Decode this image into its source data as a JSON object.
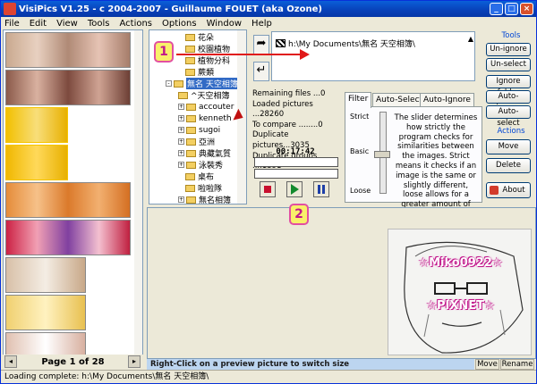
{
  "window": {
    "title": "VisiPics V1.25 - c 2004-2007 - Guillaume FOUET (aka Ozone)"
  },
  "menu": [
    "File",
    "Edit",
    "View",
    "Tools",
    "Actions",
    "Options",
    "Window",
    "Help"
  ],
  "tree": {
    "items": [
      {
        "label": "花朵",
        "expander": ""
      },
      {
        "label": "校園植物",
        "expander": ""
      },
      {
        "label": "植物分科",
        "expander": ""
      },
      {
        "label": "蕨類",
        "expander": ""
      },
      {
        "label": "無名 天空相簿",
        "expander": "-",
        "selected": true
      },
      {
        "label": "^天空相簿",
        "expander": ""
      },
      {
        "label": "accouter",
        "expander": "+"
      },
      {
        "label": "kenneth",
        "expander": "+"
      },
      {
        "label": "sugoi",
        "expander": "+"
      },
      {
        "label": "亞洲",
        "expander": "+"
      },
      {
        "label": "典藏氣質",
        "expander": "+"
      },
      {
        "label": "泳裝秀",
        "expander": "+"
      },
      {
        "label": "桌布",
        "expander": ""
      },
      {
        "label": "啦啦隊",
        "expander": ""
      },
      {
        "label": "無名相簿",
        "expander": "+"
      }
    ]
  },
  "path_list": {
    "entry": "h:\\My Documents\\無名 天空相簿\\"
  },
  "stats": {
    "remaining": "Remaining files ...0",
    "loaded": "Loaded pictures ...28260",
    "compare": "To compare ........0",
    "dup_pictures": "Duplicate pictures...3035",
    "dup_groups": "Duplicate groups ....1391"
  },
  "timer": "00:17:42",
  "tabs": [
    "Filter",
    "Auto-Select",
    "Auto-Ignore"
  ],
  "filter": {
    "ticks": [
      "Strict",
      "Basic",
      "Loose"
    ],
    "level_label": "Basic",
    "description": "The slider determines how strictly the program checks for similarities between the images. Strict means it checks if an image is the same or slightly different, loose allows for a greater amount of differences."
  },
  "right_panel": {
    "tools_label": "Tools",
    "tools": [
      "Un-ignore",
      "Un-select",
      "Ignore folder",
      "Auto-ignore",
      "Auto-select"
    ],
    "actions_label": "Actions",
    "actions": [
      "Move",
      "Delete"
    ],
    "about": "About"
  },
  "left": {
    "page": "Page 1 of 28"
  },
  "annotations": {
    "badge1": "1",
    "badge2": "2"
  },
  "preview": {
    "watermark_top": "☆Miko0922☆",
    "watermark_bottom": "☆PIXNET☆"
  },
  "message": "Right-Click on a preview picture to switch size",
  "bottom_buttons": [
    "Move",
    "Rename"
  ],
  "status": "Loading complete: h:\\My Documents\\無名 天空相簿\\"
}
